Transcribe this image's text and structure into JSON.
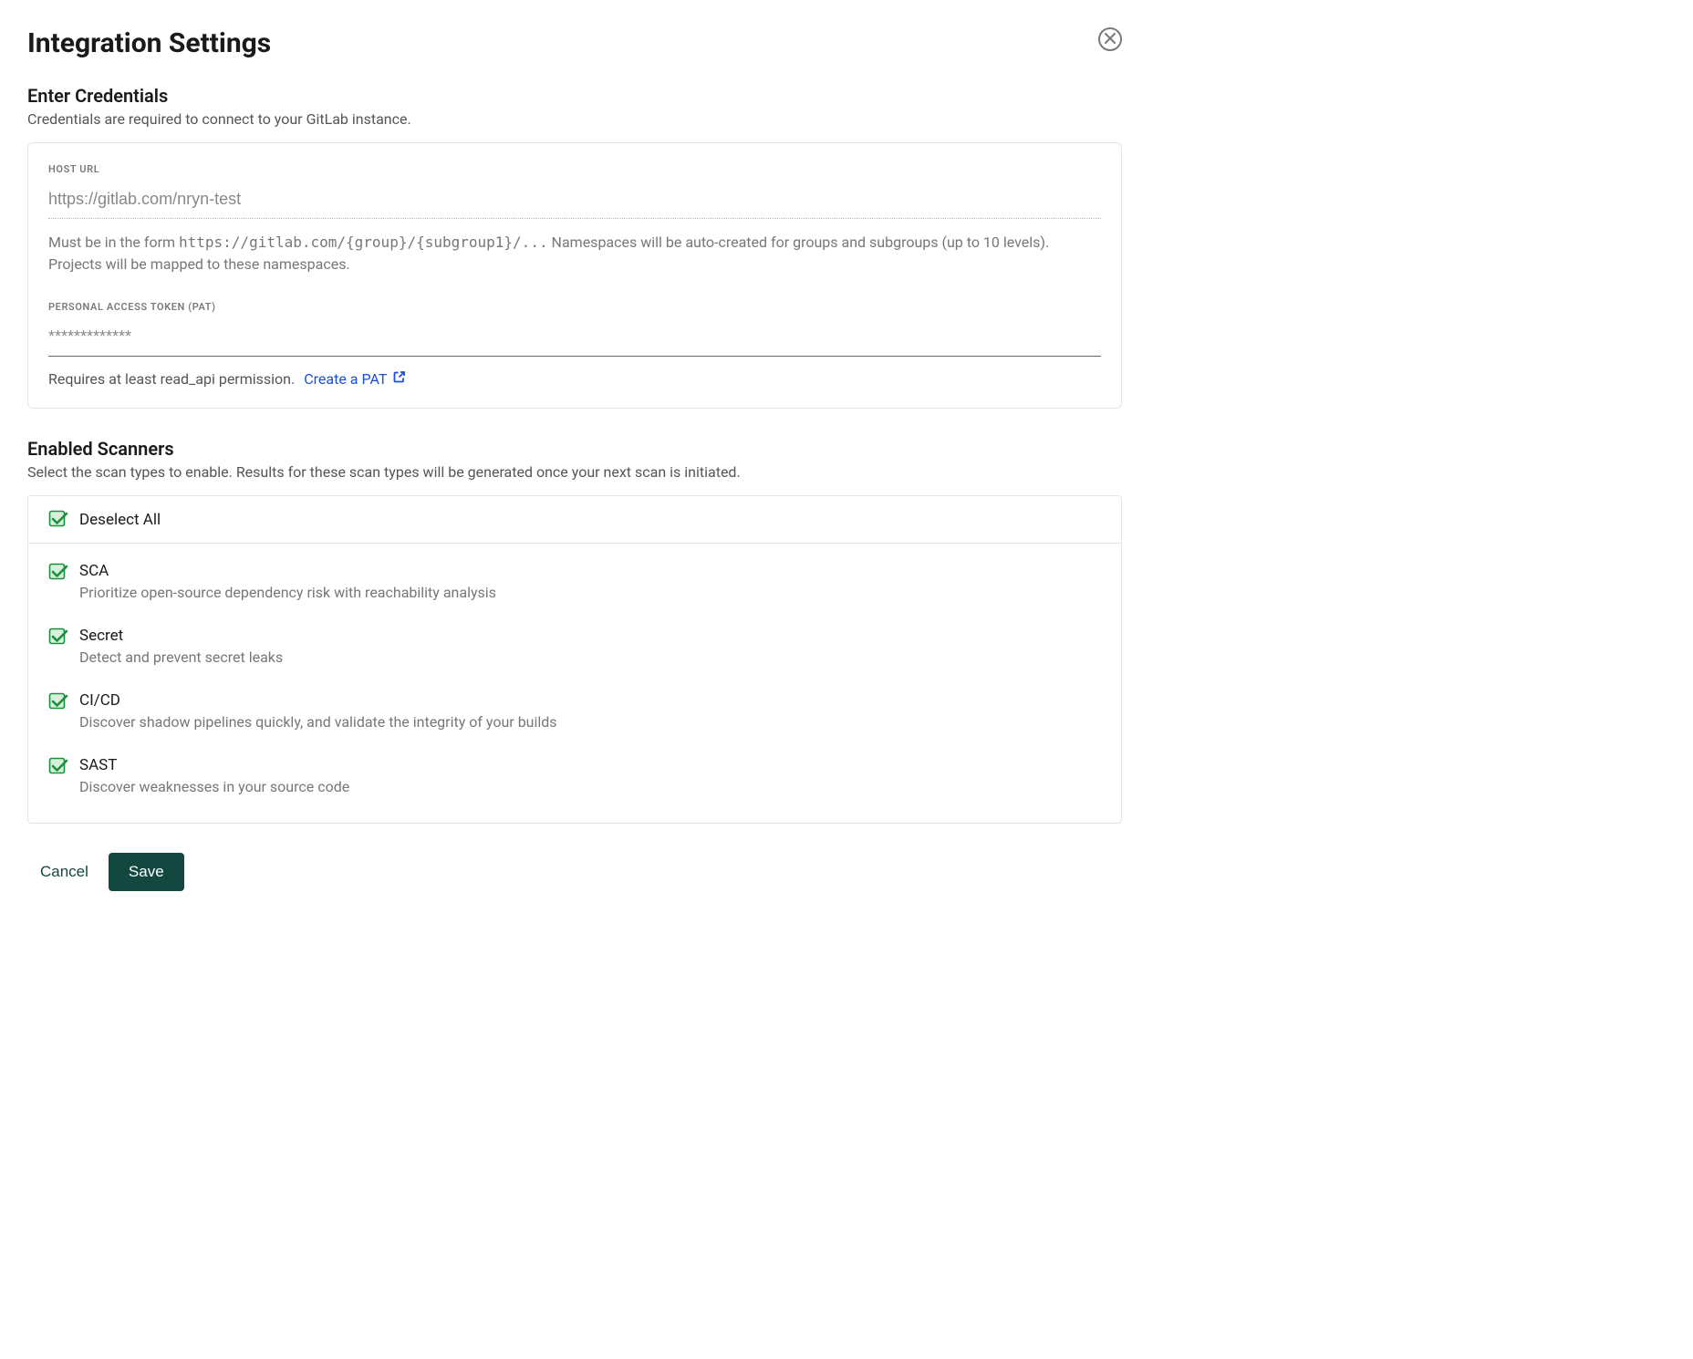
{
  "page_title": "Integration Settings",
  "credentials": {
    "section_title": "Enter Credentials",
    "section_desc": "Credentials are required to connect to your GitLab instance.",
    "host_url": {
      "label": "HOST URL",
      "value": "https://gitlab.com/nryn-test",
      "helper_prefix": "Must be in the form ",
      "helper_code": "https://gitlab.com/{group}/{subgroup1}/...",
      "helper_suffix": " Namespaces will be auto-created for groups and subgroups (up to 10 levels). Projects will be mapped to these namespaces."
    },
    "pat": {
      "label": "PERSONAL ACCESS TOKEN (PAT)",
      "value": "*************",
      "helper_text": "Requires at least read_api permission.",
      "link_text": "Create a PAT"
    }
  },
  "scanners": {
    "section_title": "Enabled Scanners",
    "section_desc": "Select the scan types to enable. Results for these scan types will be generated once your next scan is initiated.",
    "deselect_label": "Deselect All",
    "items": [
      {
        "name": "SCA",
        "desc": "Prioritize open-source dependency risk with reachability analysis"
      },
      {
        "name": "Secret",
        "desc": "Detect and prevent secret leaks"
      },
      {
        "name": "CI/CD",
        "desc": "Discover shadow pipelines quickly, and validate the integrity of your builds"
      },
      {
        "name": "SAST",
        "desc": "Discover weaknesses in your source code"
      }
    ]
  },
  "buttons": {
    "cancel": "Cancel",
    "save": "Save"
  }
}
